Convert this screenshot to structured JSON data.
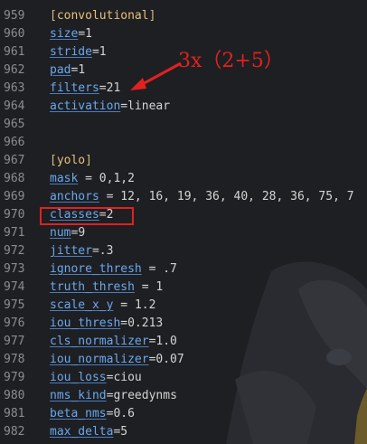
{
  "colors": {
    "background": "#1e1f22",
    "line_number": "#8a8d93",
    "section_header": "#e6c07b",
    "section_bracket": "#d7ba7d",
    "key": "#6aa8f0",
    "operator": "#d4d4d4",
    "value": "#d4d4d4",
    "annotation": "#e0221f"
  },
  "lines": [
    {
      "number": "959",
      "kind": "section",
      "name": "convolutional"
    },
    {
      "number": "960",
      "kind": "kv",
      "key": "size",
      "sep": "=",
      "value": "1"
    },
    {
      "number": "961",
      "kind": "kv",
      "key": "stride",
      "sep": "=",
      "value": "1"
    },
    {
      "number": "962",
      "kind": "kv",
      "key": "pad",
      "sep": "=",
      "value": "1"
    },
    {
      "number": "963",
      "kind": "kv",
      "key": "filters",
      "sep": "=",
      "value": "21"
    },
    {
      "number": "964",
      "kind": "kv",
      "key": "activation",
      "sep": "=",
      "value": "linear"
    },
    {
      "number": "965",
      "kind": "blank"
    },
    {
      "number": "966",
      "kind": "blank"
    },
    {
      "number": "967",
      "kind": "section",
      "name": "yolo"
    },
    {
      "number": "968",
      "kind": "kv",
      "key": "mask",
      "sep": " = ",
      "value": "0,1,2"
    },
    {
      "number": "969",
      "kind": "kv",
      "key": "anchors",
      "sep": " = ",
      "value": "12, 16, 19, 36, 40, 28, 36, 75, 7"
    },
    {
      "number": "970",
      "kind": "kv",
      "key": "classes",
      "sep": "=",
      "value": "2"
    },
    {
      "number": "971",
      "kind": "kv",
      "key": "num",
      "sep": "=",
      "value": "9"
    },
    {
      "number": "972",
      "kind": "kv",
      "key": "jitter",
      "sep": "=",
      "value": ".3"
    },
    {
      "number": "973",
      "kind": "kv",
      "key": "ignore_thresh",
      "sep": " = ",
      "value": ".7"
    },
    {
      "number": "974",
      "kind": "kv",
      "key": "truth_thresh",
      "sep": " = ",
      "value": "1"
    },
    {
      "number": "975",
      "kind": "kv",
      "key": "scale_x_y",
      "sep": " = ",
      "value": "1.2"
    },
    {
      "number": "976",
      "kind": "kv",
      "key": "iou_thresh",
      "sep": "=",
      "value": "0.213"
    },
    {
      "number": "977",
      "kind": "kv",
      "key": "cls_normalizer",
      "sep": "=",
      "value": "1.0"
    },
    {
      "number": "978",
      "kind": "kv",
      "key": "iou_normalizer",
      "sep": "=",
      "value": "0.07"
    },
    {
      "number": "979",
      "kind": "kv",
      "key": "iou_loss",
      "sep": "=",
      "value": "ciou"
    },
    {
      "number": "980",
      "kind": "kv",
      "key": "nms_kind",
      "sep": "=",
      "value": "greedynms"
    },
    {
      "number": "981",
      "kind": "kv",
      "key": "beta_nms",
      "sep": "=",
      "value": "0.6"
    },
    {
      "number": "982",
      "kind": "kv",
      "key": "max_delta",
      "sep": "=",
      "value": "5"
    }
  ],
  "annotation": {
    "text": "3x（2+5）"
  }
}
